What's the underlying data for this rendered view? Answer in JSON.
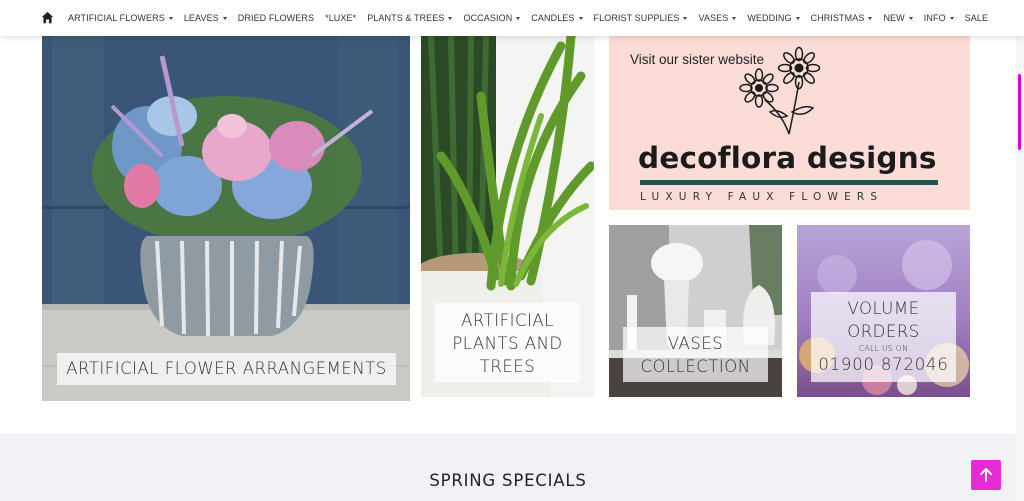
{
  "nav": {
    "items": [
      {
        "label": "ARTIFICIAL FLOWERS",
        "dropdown": true
      },
      {
        "label": "LEAVES",
        "dropdown": true
      },
      {
        "label": "DRIED FLOWERS",
        "dropdown": false
      },
      {
        "label": "*LUXE*",
        "dropdown": false
      },
      {
        "label": "PLANTS & TREES",
        "dropdown": true
      },
      {
        "label": "OCCASION",
        "dropdown": true
      },
      {
        "label": "CANDLES",
        "dropdown": true
      },
      {
        "label": "FLORIST SUPPLIES",
        "dropdown": true
      },
      {
        "label": "VASES",
        "dropdown": true
      },
      {
        "label": "WEDDING",
        "dropdown": true
      },
      {
        "label": "CHRISTMAS",
        "dropdown": true
      },
      {
        "label": "NEW",
        "dropdown": true
      },
      {
        "label": "INFO",
        "dropdown": true
      },
      {
        "label": "SALE",
        "dropdown": false
      }
    ]
  },
  "tiles": {
    "arrangements": {
      "caption": "ARTIFICIAL FLOWER ARRANGEMENTS"
    },
    "plants": {
      "caption_lines": [
        "ARTIFICIAL",
        "PLANTS AND",
        "TREES"
      ]
    },
    "sister": {
      "intro": "Visit our sister website",
      "brand": "decoflora designs",
      "tagline": "LUXURY FAUX FLOWERS"
    },
    "vases": {
      "caption_lines": [
        "VASES",
        "COLLECTION"
      ]
    },
    "volume": {
      "title_lines": [
        "VOLUME",
        "ORDERS"
      ],
      "call_label": "CALL US ON",
      "phone": "01900 872046"
    }
  },
  "specials": {
    "title": "SPRING SPECIALS"
  },
  "colors": {
    "accent": "#e62ad6",
    "scroll_thumb": "#d700d7",
    "sister_bg": "#fcdcd7",
    "band_bg": "#f1f2f6"
  },
  "icons": {
    "home": "home-icon",
    "back_to_top": "arrow-up-icon",
    "nav_caret": "caret-down-icon"
  }
}
